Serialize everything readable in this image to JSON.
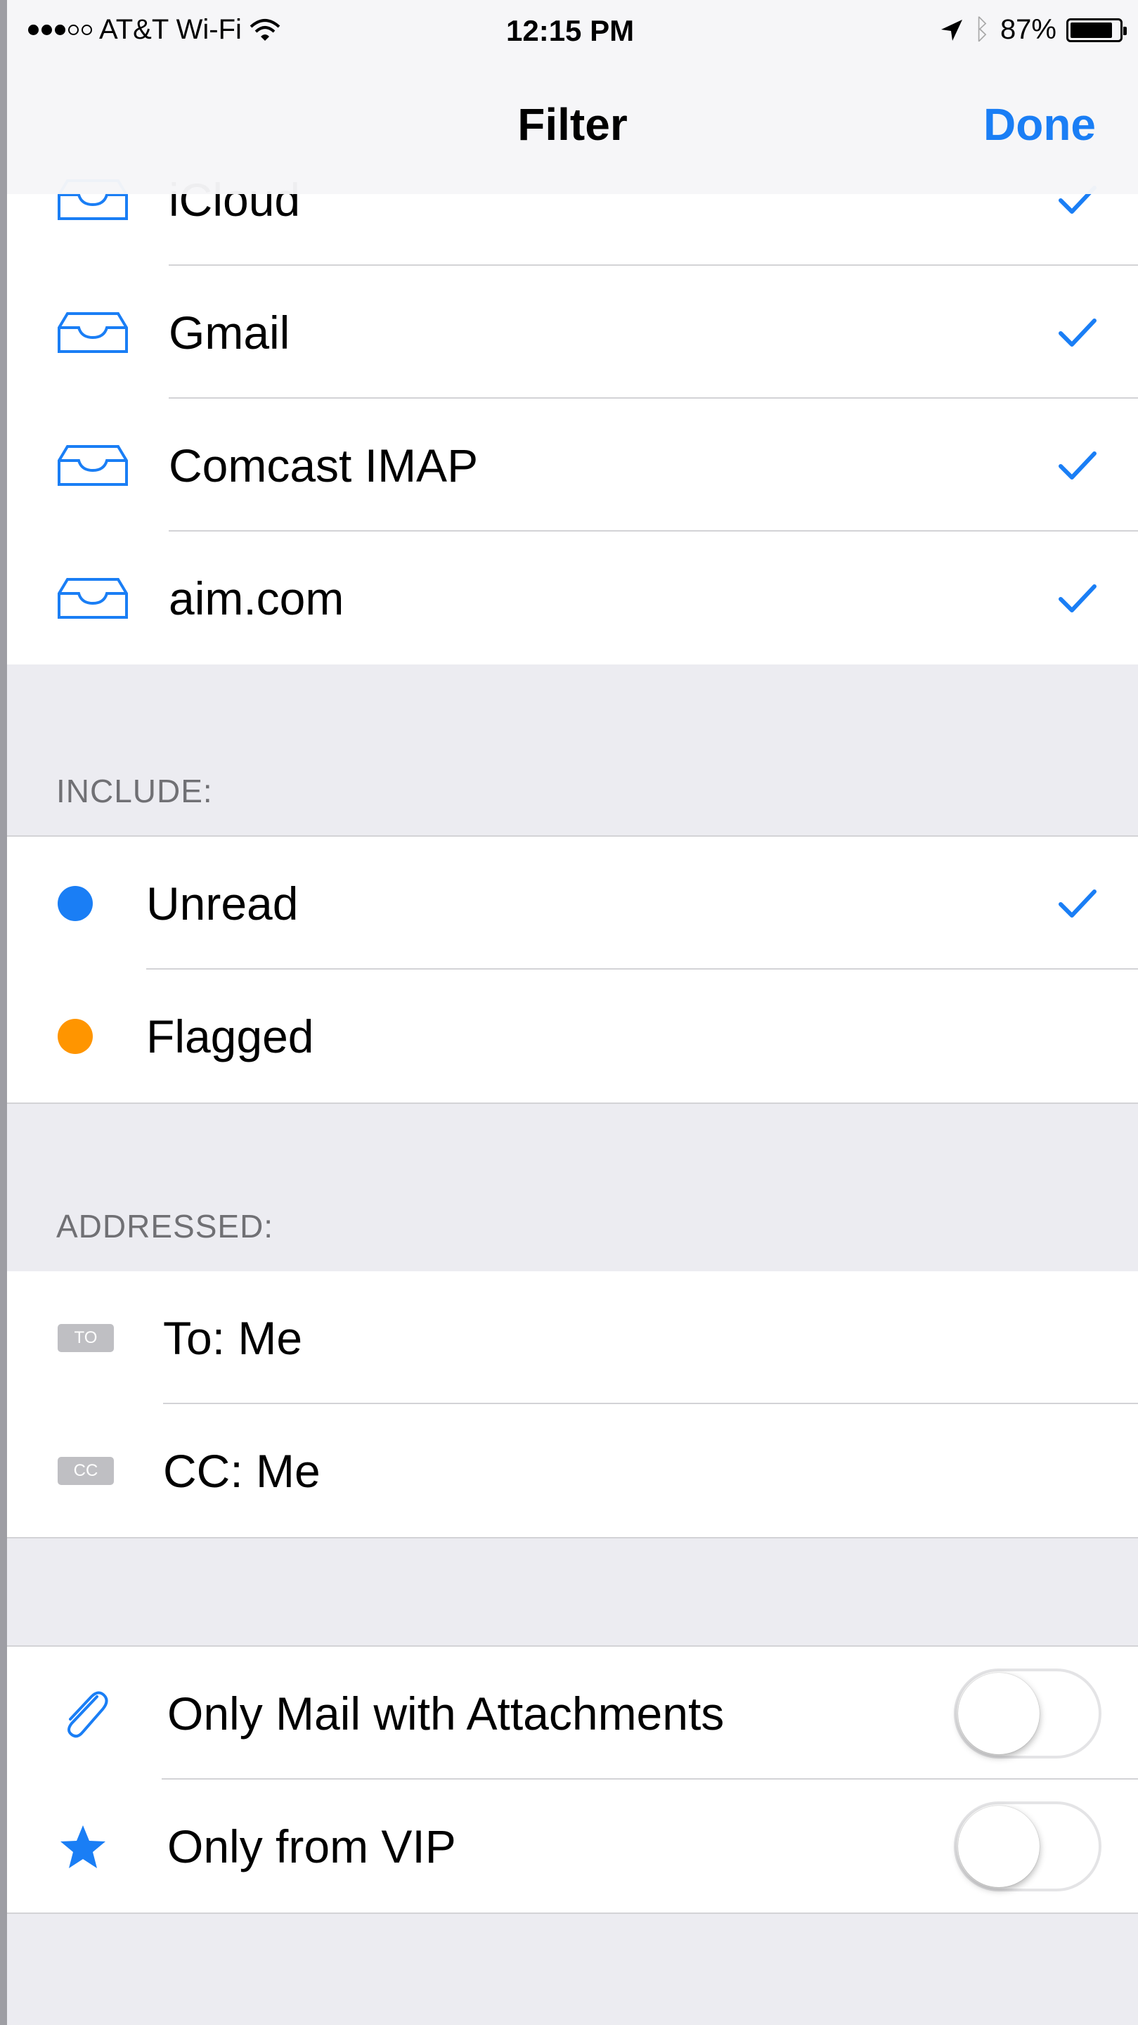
{
  "status_bar": {
    "carrier": "AT&T Wi-Fi",
    "signal_bars_filled": 3,
    "signal_bars_total": 5,
    "time": "12:15 PM",
    "battery_percent_label": "87%",
    "battery_level": 0.87
  },
  "nav": {
    "title": "Filter",
    "done_label": "Done"
  },
  "accounts": [
    {
      "label": "iCloud",
      "checked": true,
      "icon": "inbox-tray-icon"
    },
    {
      "label": "Gmail",
      "checked": true,
      "icon": "inbox-tray-icon"
    },
    {
      "label": "Comcast IMAP",
      "checked": true,
      "icon": "inbox-tray-icon"
    },
    {
      "label": "aim.com",
      "checked": true,
      "icon": "inbox-tray-icon"
    }
  ],
  "include": {
    "header": "INCLUDE:",
    "items": [
      {
        "label": "Unread",
        "checked": true,
        "color": "#1a7ef5"
      },
      {
        "label": "Flagged",
        "checked": false,
        "color": "#ff9500"
      }
    ]
  },
  "addressed": {
    "header": "ADDRESSED:",
    "items": [
      {
        "label": "To: Me",
        "badge": "TO",
        "checked": false
      },
      {
        "label": "CC: Me",
        "badge": "CC",
        "checked": false
      }
    ]
  },
  "options": [
    {
      "label": "Only Mail with Attachments",
      "icon": "paperclip-icon",
      "enabled": false
    },
    {
      "label": "Only from VIP",
      "icon": "star-icon",
      "enabled": false
    }
  ],
  "colors": {
    "accent": "#1a7ef5",
    "flag": "#ff9500",
    "group_background": "#ececf1",
    "separator": "#d3d3d6"
  }
}
